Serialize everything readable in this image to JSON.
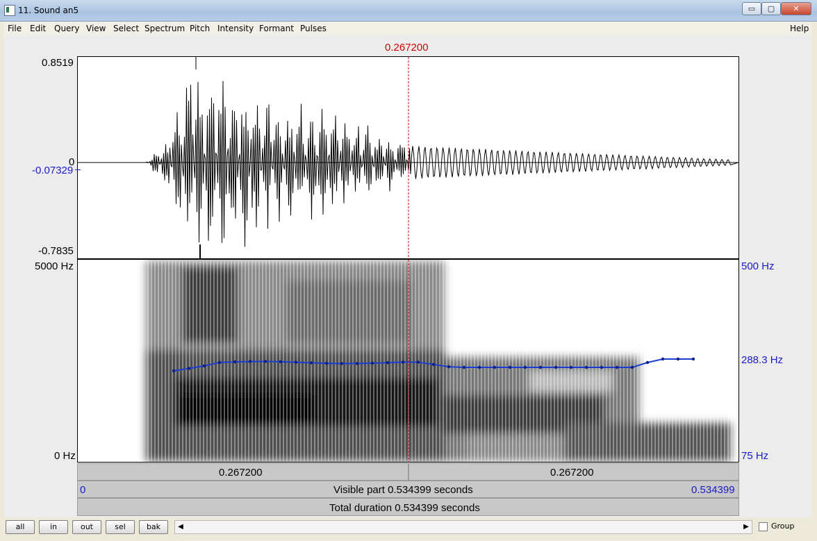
{
  "window": {
    "title": "11. Sound an5",
    "controls": [
      "▭",
      "▢",
      "✕"
    ]
  },
  "menu": {
    "items": [
      "File",
      "Edit",
      "Query",
      "View",
      "Select",
      "Spectrum",
      "Pitch",
      "Intensity",
      "Formant",
      "Pulses"
    ],
    "help": "Help"
  },
  "cursor": {
    "time_label": "0.267200",
    "time_s": 0.2672
  },
  "waveform": {
    "max_label": "0.8519",
    "zero_label": "0",
    "cursor_value_label": "-0.07329",
    "min_label": "-0.7835"
  },
  "spectrogram": {
    "top_label": "5000 Hz",
    "bottom_label": "0 Hz"
  },
  "pitch": {
    "top_label": "500 Hz",
    "cursor_label": "288.3 Hz",
    "bottom_label": "75 Hz",
    "color": "#1a3fd0"
  },
  "timebar": {
    "left_label": "0.267200",
    "right_label": "0.267200"
  },
  "visible": {
    "start": "0",
    "label": "Visible part 0.534399 seconds",
    "end": "0.534399"
  },
  "total": {
    "label": "Total duration 0.534399 seconds"
  },
  "buttons": {
    "all": "all",
    "in": "in",
    "out": "out",
    "sel": "sel",
    "bak": "bak"
  },
  "scroll": {
    "left_arrow": "◀",
    "right_arrow": "▶"
  },
  "group": {
    "label": "Group",
    "checked": false
  },
  "colors": {
    "cursor": "#d00000",
    "axis_blue": "#1a1acc"
  }
}
